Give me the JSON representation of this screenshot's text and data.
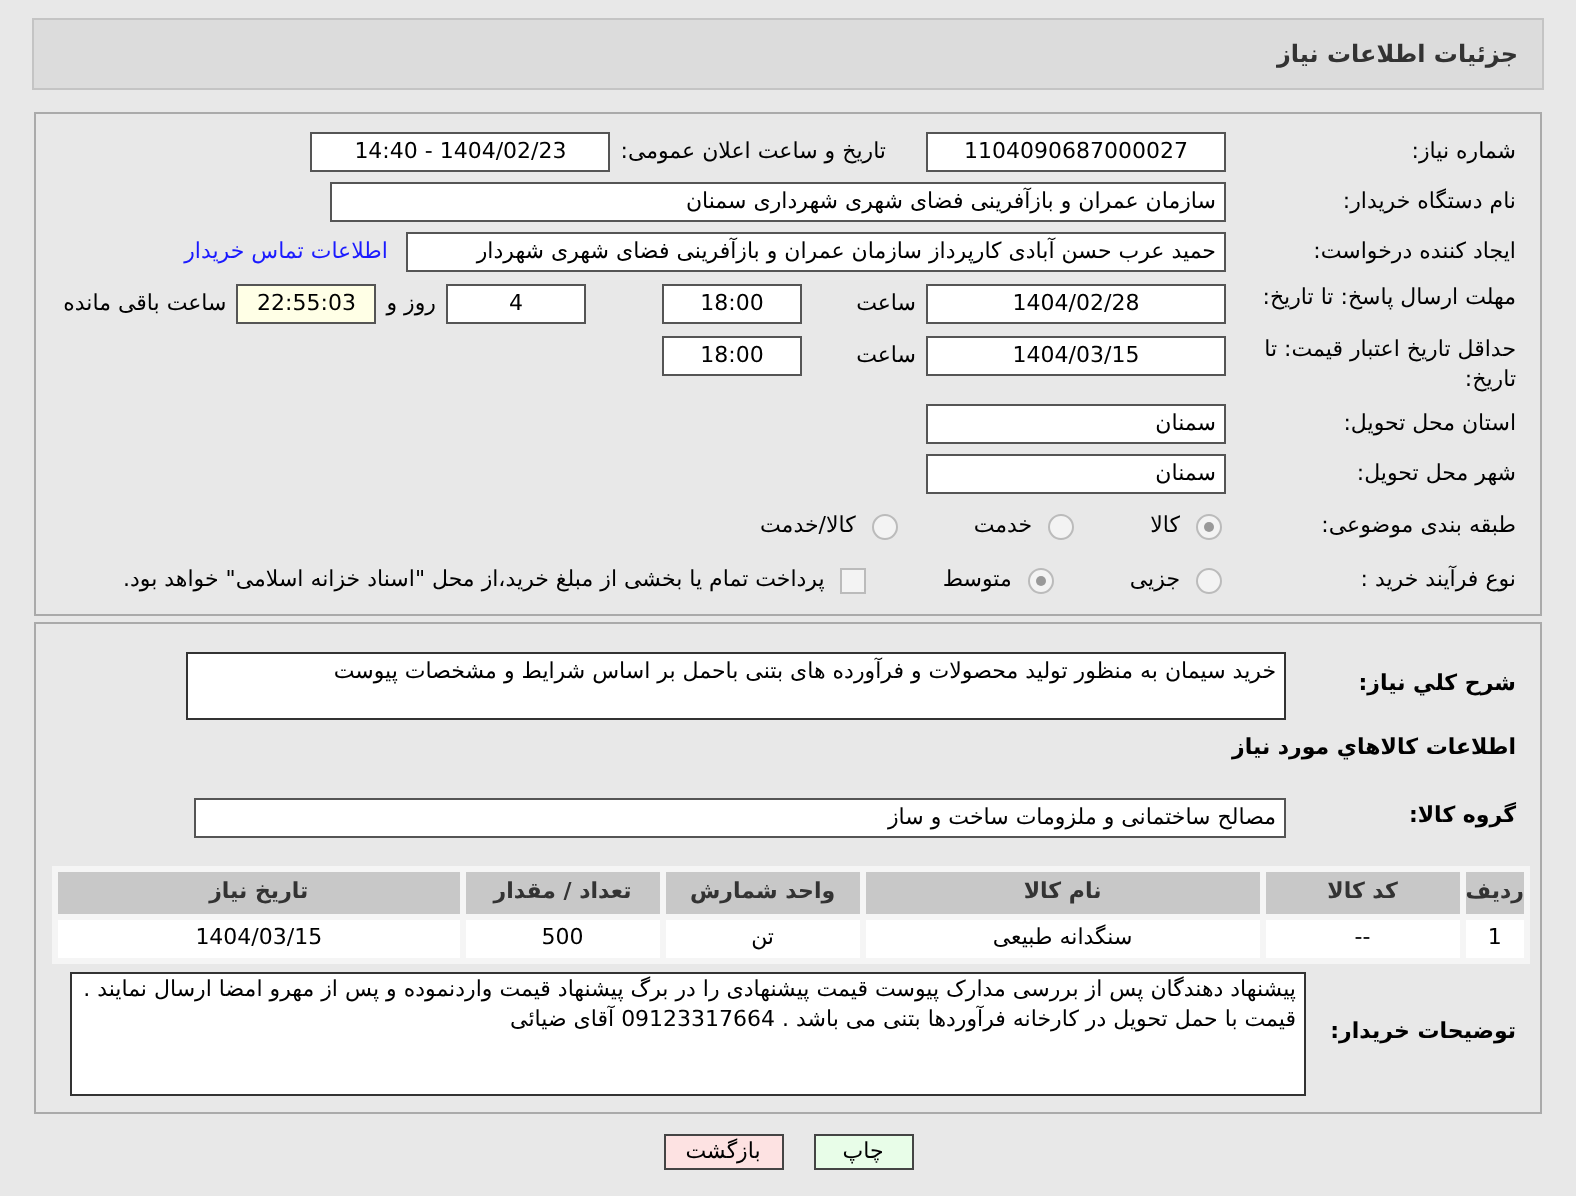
{
  "header": {
    "title": "جزئیات اطلاعات نیاز"
  },
  "need_number": {
    "label": "شماره نیاز:",
    "value": "1104090687000027"
  },
  "announce": {
    "label": "تاریخ و ساعت اعلان عمومی:",
    "value": "1404/02/23 - 14:40"
  },
  "buyer": {
    "label": "نام دستگاه خریدار:",
    "value": "سازمان عمران و بازآفرینی فضای شهری شهرداری سمنان"
  },
  "requester": {
    "label": "ایجاد کننده درخواست:",
    "value": "حمید عرب حسن آبادی کارپرداز سازمان عمران و بازآفرینی فضای شهری شهردار",
    "link": "اطلاعات تماس خریدار"
  },
  "deadline": {
    "label": "مهلت ارسال پاسخ: تا تاریخ:",
    "date": "1404/02/28",
    "time_label": "ساعت",
    "time": "18:00",
    "days": "4",
    "days_label": "روز و",
    "remaining": "22:55:03",
    "remaining_label": "ساعت باقی مانده"
  },
  "validity": {
    "label": "حداقل تاریخ اعتبار قیمت: تا تاریخ:",
    "date": "1404/03/15",
    "time_label": "ساعت",
    "time": "18:00"
  },
  "province": {
    "label": "استان محل تحویل:",
    "value": "سمنان"
  },
  "city": {
    "label": "شهر محل تحویل:",
    "value": "سمنان"
  },
  "category": {
    "label": "طبقه بندی موضوعی:",
    "options": [
      {
        "label": "کالا",
        "selected": true
      },
      {
        "label": "خدمت",
        "selected": false
      },
      {
        "label": "کالا/خدمت",
        "selected": false
      }
    ]
  },
  "process": {
    "label": "نوع فرآیند خرید :",
    "options": [
      {
        "label": "جزیی",
        "selected": false
      },
      {
        "label": "متوسط",
        "selected": true
      }
    ],
    "payment": {
      "label": "پرداخت تمام یا بخشی از مبلغ خرید،از محل \"اسناد خزانه اسلامی\" خواهد بود.",
      "checked": false
    }
  },
  "description": {
    "label": "شرح كلي نياز:",
    "value": "خرید سیمان به منظور تولید محصولات و فرآورده های بتنی باحمل بر اساس شرایط و مشخصات پیوست"
  },
  "goods_title": "اطلاعات كالاهاي مورد نياز",
  "group": {
    "label": "گروه کالا:",
    "value": "مصالح ساختمانی و ملزومات ساخت و ساز"
  },
  "table": {
    "columns": [
      "ردیف",
      "کد کالا",
      "نام کالا",
      "واحد شمارش",
      "تعداد / مقدار",
      "تاریخ نیاز"
    ],
    "rows": [
      [
        "1",
        "--",
        "سنگدانه طبیعی",
        "تن",
        "500",
        "1404/03/15"
      ]
    ]
  },
  "notes": {
    "label": "توضیحات خریدار:",
    "value": "پیشنهاد دهندگان پس از بررسی مدارک پیوست قیمت پیشنهادی را در برگ پیشنهاد قیمت واردنموده و پس از مهرو امضا ارسال نمایند . قیمت با حمل تحویل در کارخانه فرآوردها بتنی می باشد . 09123317664 آقای ضیائی"
  },
  "buttons": [
    {
      "label": "چاپ",
      "kind": "print"
    },
    {
      "label": "بازگشت",
      "kind": "back"
    }
  ]
}
